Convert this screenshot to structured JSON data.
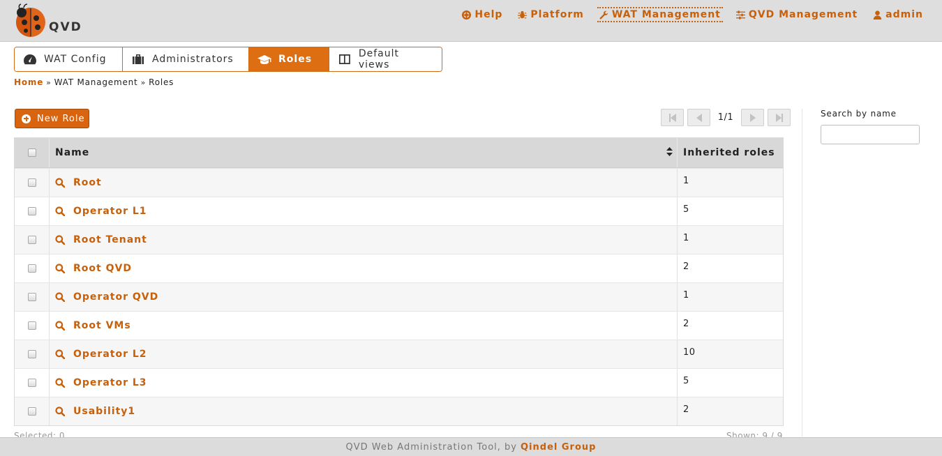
{
  "header": {
    "logo_text": "QVD",
    "nav": [
      {
        "label": "Help",
        "icon": "lifebuoy-icon"
      },
      {
        "label": "Platform",
        "icon": "bug-icon"
      },
      {
        "label": "WAT Management",
        "icon": "wrench-icon",
        "active": true
      },
      {
        "label": "QVD Management",
        "icon": "sliders-icon"
      },
      {
        "label": "admin",
        "icon": "user-icon"
      }
    ]
  },
  "tabs": [
    {
      "label": "WAT Config",
      "icon": "dashboard-icon"
    },
    {
      "label": "Administrators",
      "icon": "briefcase-icon"
    },
    {
      "label": "Roles",
      "icon": "graduation-cap-icon",
      "active": true
    },
    {
      "label": "Default views",
      "icon": "columns-icon"
    }
  ],
  "breadcrumb": {
    "home": "Home",
    "section": "WAT Management",
    "current": "Roles"
  },
  "toolbar": {
    "new_role_label": "New Role"
  },
  "pagination": {
    "text": "1/1"
  },
  "table": {
    "headers": {
      "name": "Name",
      "inherited": "Inherited roles"
    },
    "rows": [
      {
        "name": "Root",
        "inherited": "1"
      },
      {
        "name": "Operator L1",
        "inherited": "5"
      },
      {
        "name": "Root Tenant",
        "inherited": "1"
      },
      {
        "name": "Root QVD",
        "inherited": "2"
      },
      {
        "name": "Operator QVD",
        "inherited": "1"
      },
      {
        "name": "Root VMs",
        "inherited": "2"
      },
      {
        "name": "Operator L2",
        "inherited": "10"
      },
      {
        "name": "Operator L3",
        "inherited": "5"
      },
      {
        "name": "Usability1",
        "inherited": "2"
      }
    ]
  },
  "status": {
    "selected": "Selected: 0",
    "shown": "Shown: 9 / 9"
  },
  "sidebar": {
    "search_label": "Search by name",
    "search_value": ""
  },
  "footer": {
    "text": "QVD Web Administration Tool, by",
    "company": "Qindel Group"
  },
  "colors": {
    "accent": "#d9640f",
    "link": "#c8600a",
    "header_bg": "#dedede"
  }
}
